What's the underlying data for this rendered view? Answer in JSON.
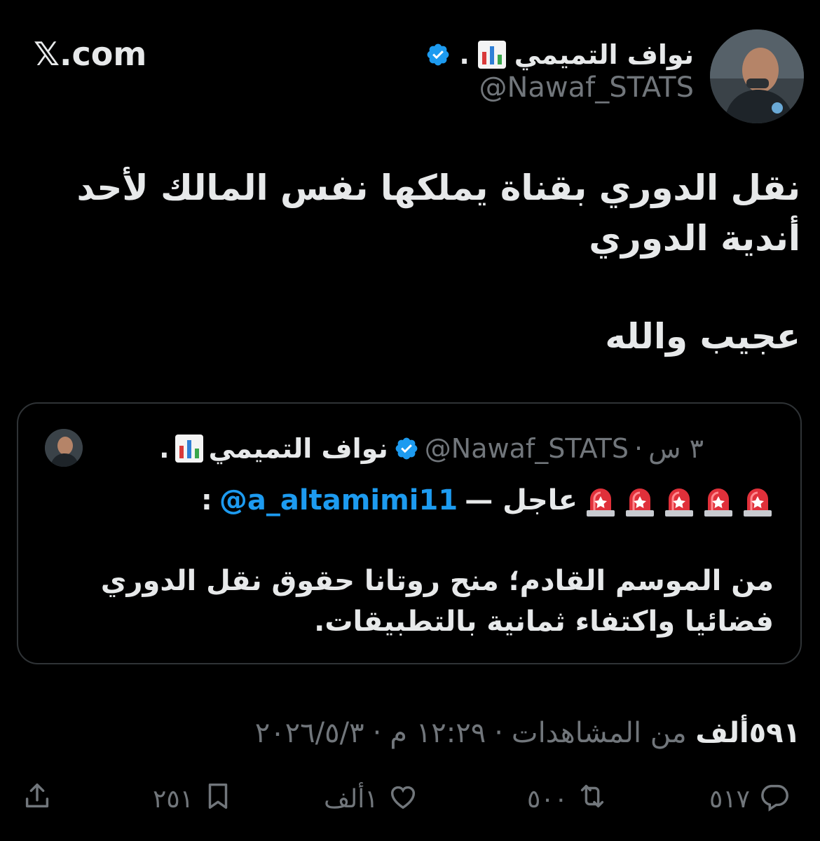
{
  "brand": {
    "text": "𝕏.com"
  },
  "author": {
    "name": "نواف التميمي",
    "name_dot": ".",
    "handle": "@Nawaf_STATS"
  },
  "tweet": {
    "text_main": "نقل الدوري بقناة يملكها نفس المالك لأحد أندية الدوري",
    "text_secondary": "عجيب والله"
  },
  "quote": {
    "name": "نواف التميمي",
    "name_dot": ".",
    "handle": "@Nawaf_STATS",
    "separator": "·",
    "time": "٣ س",
    "breaking_label": "عاجل —",
    "mention": "@a_altamimi11",
    "colon": ":",
    "body": "من الموسم القادم؛ منح روتانا حقوق نقل الدوري فضائيا واكتفاء ثمانية بالتطبيقات."
  },
  "meta": {
    "date": "٢٠٢٦/٥/٣",
    "sep1": "·",
    "time": "١٢:٢٩ م",
    "sep2": "·",
    "views_count": "٥٩١ألف",
    "views_label": "من المشاهدات"
  },
  "actions": {
    "replies": "٥١٧",
    "reposts": "٥٠٠",
    "likes": "١ألف",
    "bookmarks": "٢٥١"
  },
  "colors": {
    "background": "#000000",
    "text": "#e7e9ea",
    "secondary": "#71767b",
    "accent": "#1d9bf0",
    "border": "#2f3336"
  },
  "icons": {
    "verified": "verified-badge-icon",
    "chart": "bar-chart-icon",
    "siren": "siren-icon",
    "reply": "reply-icon",
    "repost": "repost-icon",
    "like": "heart-icon",
    "bookmark": "bookmark-icon",
    "share": "share-icon"
  }
}
